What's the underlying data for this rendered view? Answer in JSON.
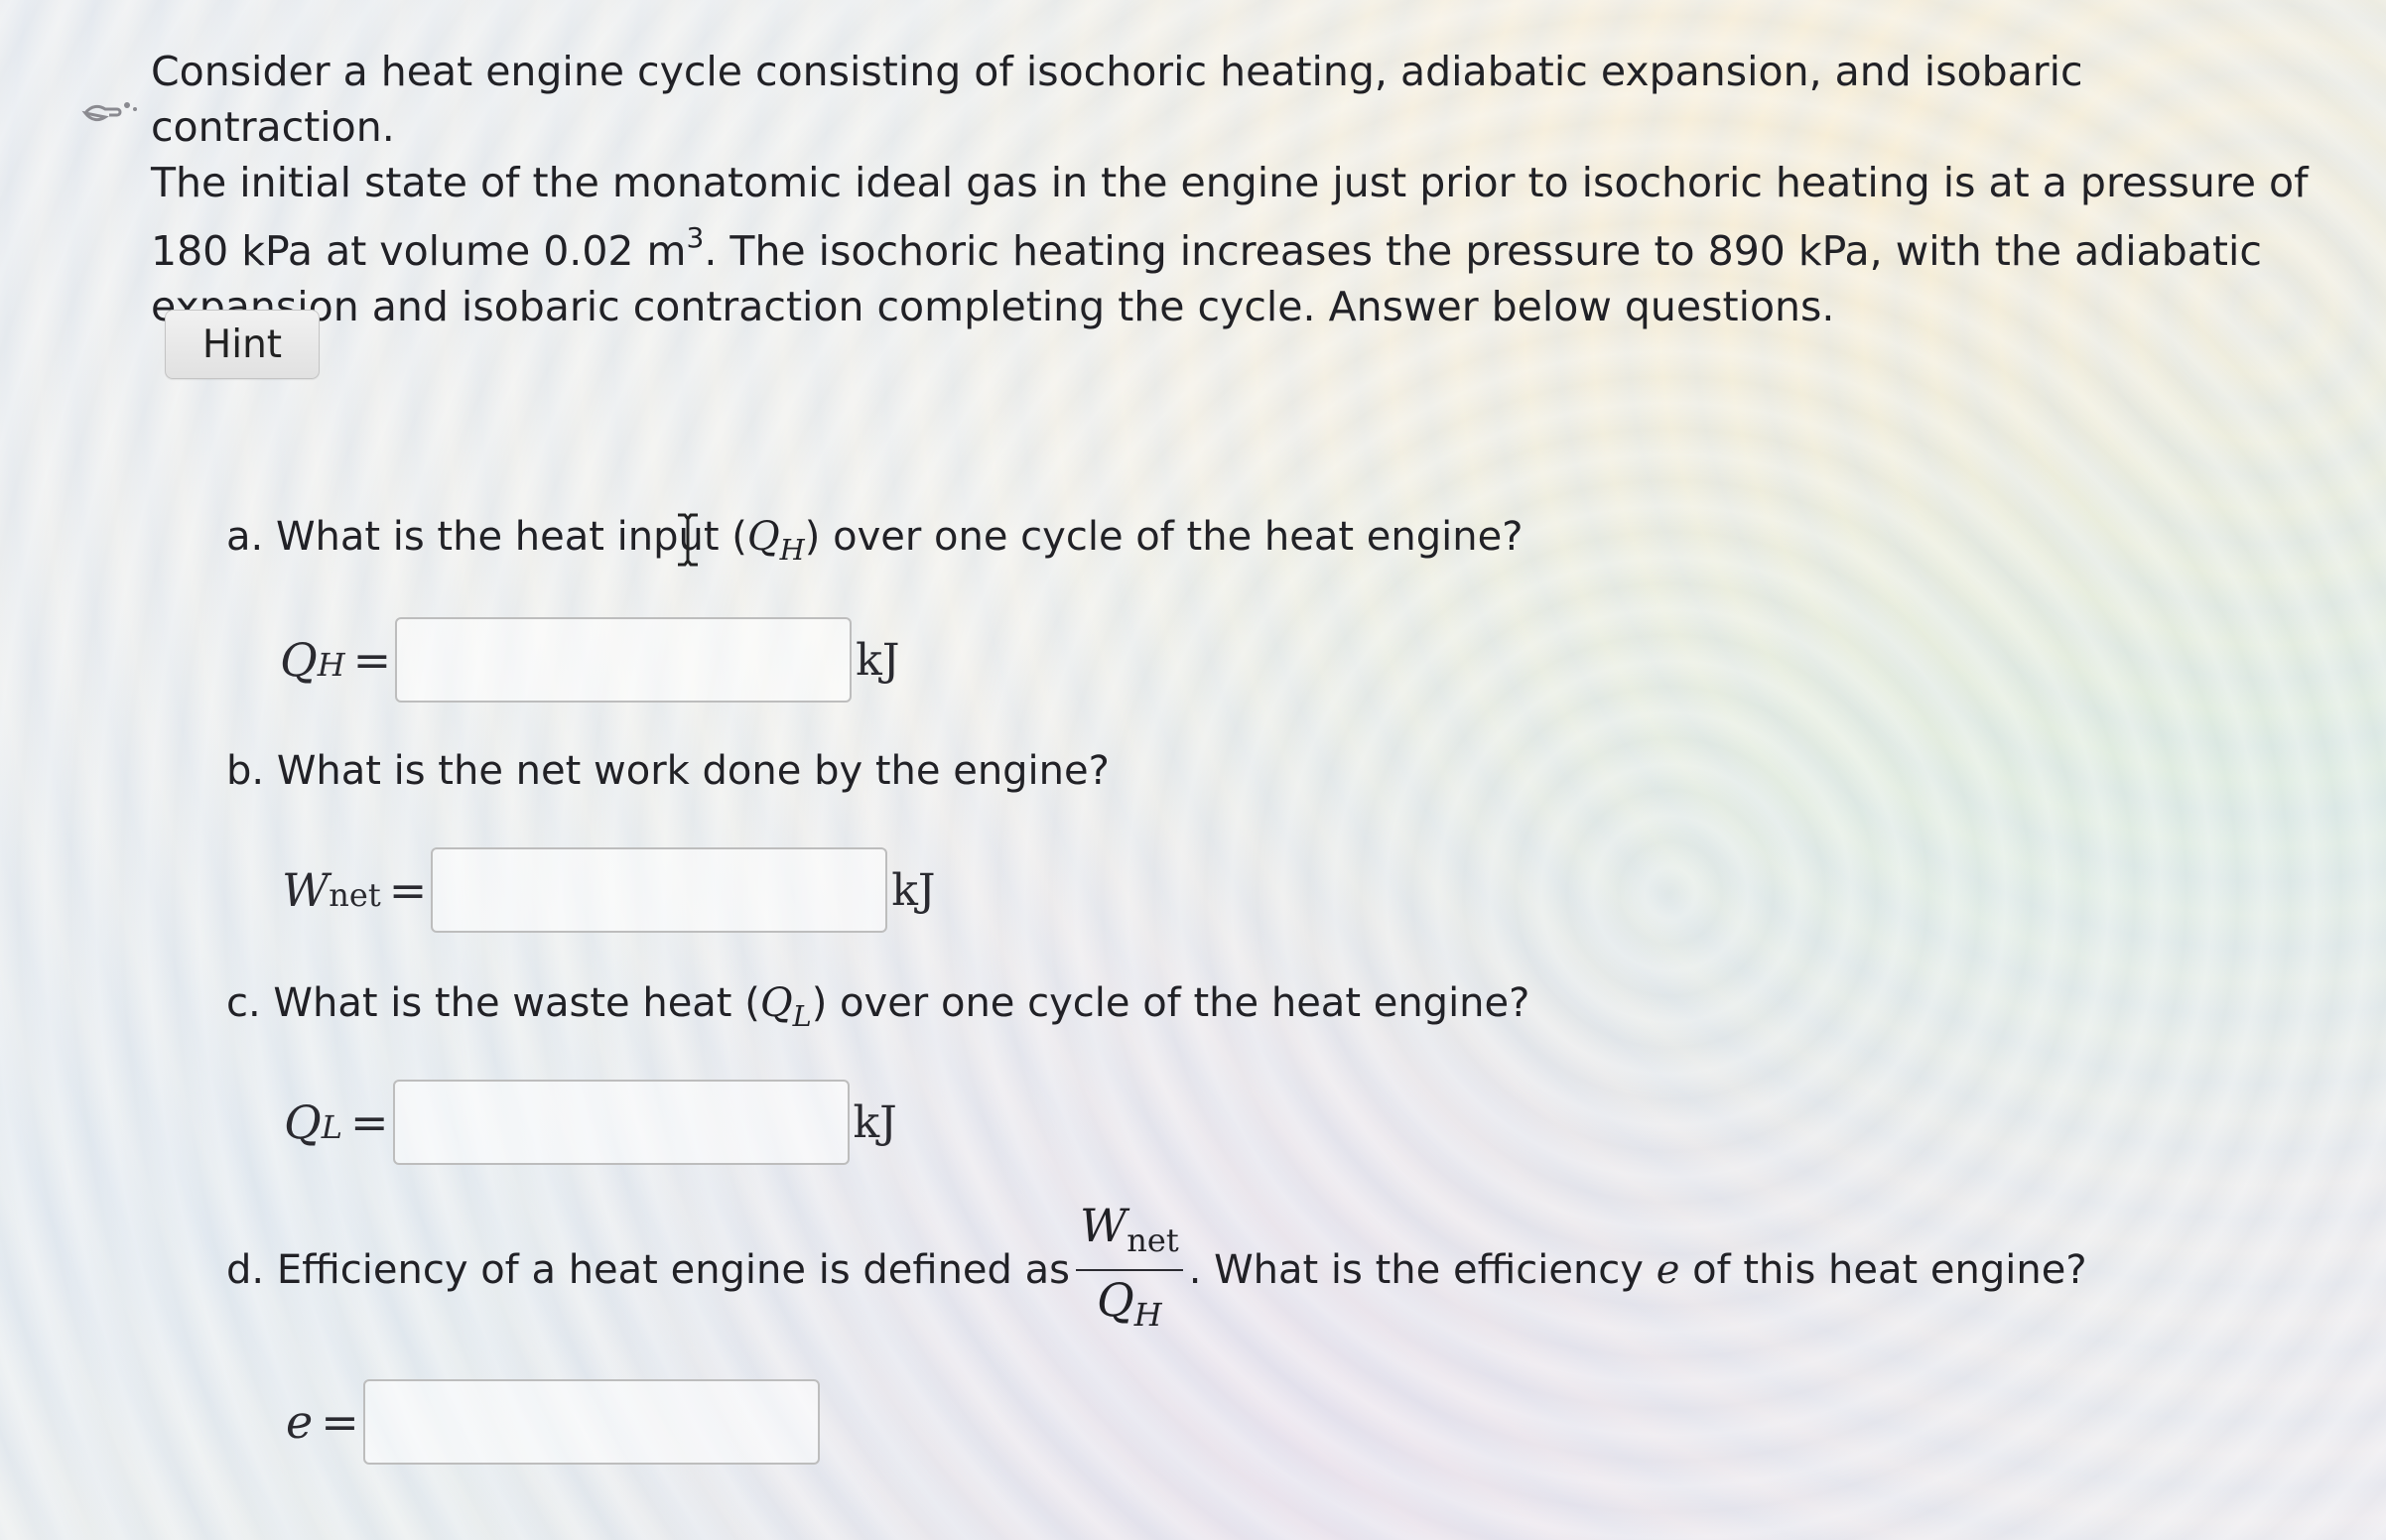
{
  "problem": {
    "lines": [
      "Consider a heat engine cycle consisting of isochoric heating, adiabatic expansion, and isobaric contraction.",
      "The initial state of the monatomic ideal gas in the engine just prior to isochoric heating is at a pressure of",
      "180 kPa at volume 0.02 m",
      ". The isochoric heating increases the pressure to 890 kPa, with the adiabatic",
      "expansion and isobaric contraction completing the cycle. Answer below questions."
    ],
    "superscript": "3"
  },
  "hint": {
    "label": "Hint"
  },
  "questions": {
    "a": {
      "prefix": "a. What is the heat input (",
      "symbol": "Q",
      "symbol_sub": "H",
      "suffix": ") over one cycle of the heat engine?",
      "answer_symbol": "Q",
      "answer_sub": "H",
      "equals": "=",
      "value": "",
      "unit": "kJ"
    },
    "b": {
      "text": "b. What is the net work done by the engine?",
      "answer_symbol": "W",
      "answer_sub": "net",
      "equals": "=",
      "value": "",
      "unit": "kJ"
    },
    "c": {
      "prefix": "c. What is the waste heat (",
      "symbol": "Q",
      "symbol_sub": "L",
      "suffix": ") over one cycle of the heat engine?",
      "answer_symbol": "Q",
      "answer_sub": "L",
      "equals": "=",
      "value": "",
      "unit": "kJ"
    },
    "d": {
      "prefix": "d. Efficiency of a heat engine is defined as",
      "frac_num": "W",
      "frac_num_sub": "net",
      "frac_den": "Q",
      "frac_den_sub": "H",
      "middle": ". What is the efficiency",
      "symbol": "e",
      "suffix": "of this heat engine?",
      "answer_symbol": "e",
      "equals": "=",
      "value": ""
    }
  }
}
